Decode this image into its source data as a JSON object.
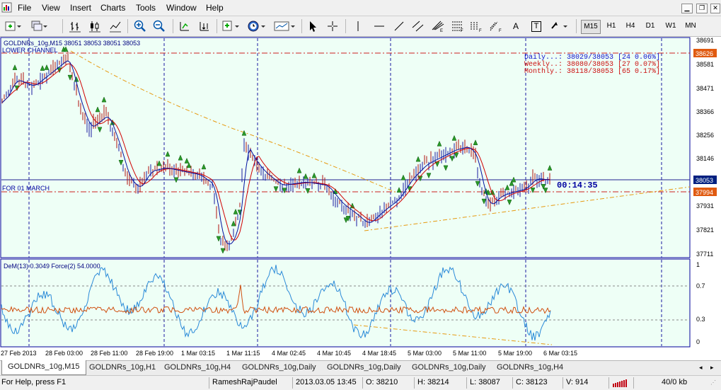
{
  "menu": [
    "File",
    "View",
    "Insert",
    "Charts",
    "Tools",
    "Window",
    "Help"
  ],
  "timeframes": [
    "M15",
    "H1",
    "H4",
    "D1",
    "W1",
    "MN"
  ],
  "active_timeframe": "M15",
  "toolbar_letters": {
    "text": "A",
    "label": "T"
  },
  "chart": {
    "header": "GOLDNRs_10g,M15  38051 38053 38051 38053",
    "channel_label": "LOWER CHANNEL",
    "march_label": "FOR 01 MARCH",
    "timer": "00:14:35",
    "info_lines": [
      {
        "text": "Daily...: 38029/38053 [24 0.06%]",
        "color": "#1010cc"
      },
      {
        "text": "Weekly..: 38080/38053 [27 0.07%]",
        "color": "#cc1010"
      },
      {
        "text": "Monthly.: 38118/38053 [65 0.17%]",
        "color": "#cc1010"
      }
    ],
    "price_ticks": [
      "38691",
      "38581",
      "38471",
      "38366",
      "38256",
      "38146",
      "37931",
      "37821",
      "37711"
    ],
    "price_markers": [
      {
        "text": "38626",
        "bg": "#e05a10"
      },
      {
        "text": "38053",
        "bg": "#002080"
      },
      {
        "text": "37994",
        "bg": "#e05a10"
      }
    ],
    "time_labels": [
      "27 Feb 2013",
      "28 Feb 03:00",
      "28 Feb 11:00",
      "28 Feb 19:00",
      "1 Mar 03:15",
      "1 Mar 11:15",
      "4 Mar 02:45",
      "4 Mar 10:45",
      "4 Mar 18:45",
      "5 Mar 03:00",
      "5 Mar 11:00",
      "5 Mar 19:00",
      "6 Mar 03:15"
    ]
  },
  "indicator": {
    "label": "DeM(13) 0.3049  Force(2) 54.0000",
    "ticks": [
      "1",
      "0.7",
      "0.3",
      "0"
    ]
  },
  "colors": {
    "bg": "#eefff6",
    "bull": "#1a1aa0",
    "bear": "#b01010",
    "ma_fast": "#0010a0",
    "ma_slow": "#d00000",
    "trend": "#e69a10",
    "dem": "#2a8ad8",
    "force": "#d05010"
  },
  "tabs": [
    "GOLDNRs_10g,M15",
    "GOLDNRs_10g,H1",
    "GOLDNRs_10g,H4",
    "GOLDNRs_10g,Daily",
    "GOLDNRs_10g,Daily",
    "GOLDNRs_10g,Daily",
    "GOLDNRs_10g,H4"
  ],
  "status": {
    "help": "For Help, press F1",
    "profile": "RameshRajPaudel",
    "datetime": "2013.03.05 13:45",
    "open": "O: 38210",
    "high": "H: 38214",
    "low": "L: 38087",
    "close": "C: 38123",
    "volume": "V: 914",
    "traffic": "40/0 kb"
  }
}
